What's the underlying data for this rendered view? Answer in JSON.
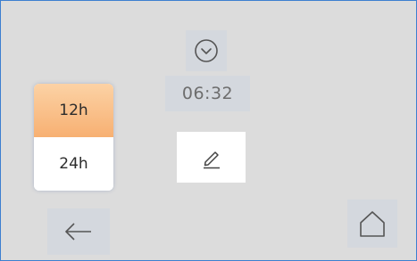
{
  "time": {
    "value": "06:32",
    "icon": "clock-icon"
  },
  "format": {
    "options": [
      {
        "label": "12h",
        "selected": true
      },
      {
        "label": "24h",
        "selected": false
      }
    ],
    "selected_color": "#f7b072"
  },
  "actions": {
    "edit_icon": "pencil-icon",
    "back_icon": "arrow-left-icon",
    "home_icon": "home-icon"
  }
}
